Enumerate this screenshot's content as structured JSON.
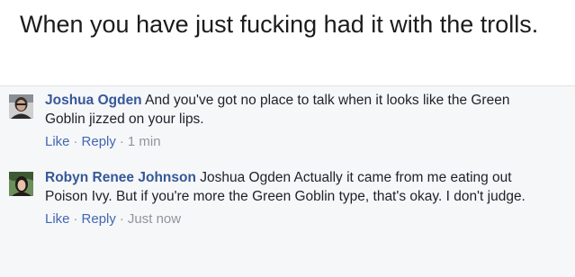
{
  "caption": "When you have just fucking had it with the trolls.",
  "comments": [
    {
      "author": "Joshua Ogden",
      "text": "And you've got no place to talk when it looks like the Green Goblin jizzed on your lips.",
      "like_label": "Like",
      "reply_label": "Reply",
      "timestamp": "1 min",
      "separator": "·"
    },
    {
      "author": "Robyn Renee Johnson",
      "mention": "Joshua Ogden",
      "text": "Actually it came from me eating out Poison Ivy. But if you're more the Green Goblin type, that's okay. I don't judge.",
      "like_label": "Like",
      "reply_label": "Reply",
      "timestamp": "Just now",
      "separator": "·"
    }
  ]
}
